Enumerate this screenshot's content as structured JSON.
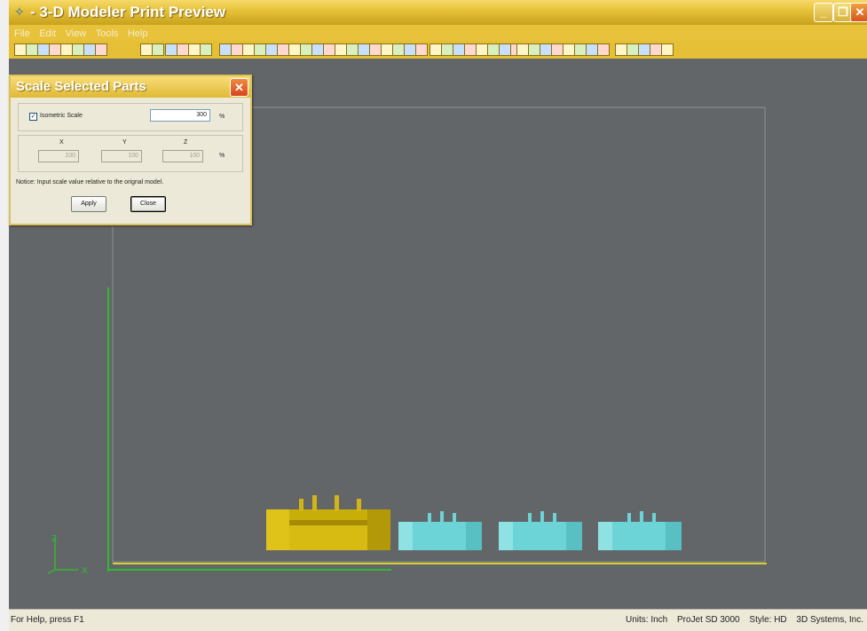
{
  "window": {
    "title": "- 3-D Modeler Print Preview",
    "icon": "app-icon",
    "controls": {
      "minimize": "_",
      "restore": "❐",
      "close": "✕"
    }
  },
  "menu": [
    "File",
    "Edit",
    "View",
    "Tools",
    "Help"
  ],
  "toolbar_icons": [
    "tool-icon"
  ],
  "dialog": {
    "title": "Scale Selected Parts",
    "close": "✕",
    "isometric_label": "Isometric Scale",
    "isometric_checked": true,
    "isometric_value": "300",
    "percent": "%",
    "axes": [
      {
        "label": "X",
        "value": "100"
      },
      {
        "label": "Y",
        "value": "100"
      },
      {
        "label": "Z",
        "value": "100"
      }
    ],
    "notice": "Notice: Input scale value relative to the orignal model.",
    "apply_label": "Apply",
    "close_label": "Close"
  },
  "axis_gizmo": {
    "z": "Z",
    "x": "X"
  },
  "colors": {
    "canvas": "#636669",
    "selected_part": "#d4b60a",
    "part": "#6fd6d8",
    "axis_green": "#2fb92f",
    "build_yellow": "#d8d02c"
  },
  "status": {
    "help": "For Help, press F1",
    "units": "Units: Inch",
    "printer": "ProJet SD 3000",
    "style": "Style: HD",
    "company": "3D Systems, Inc."
  }
}
